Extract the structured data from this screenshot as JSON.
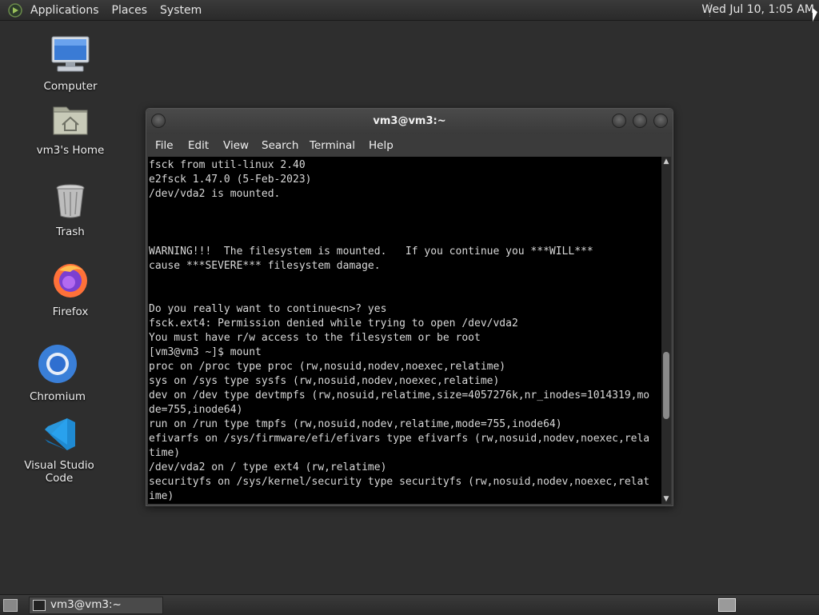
{
  "top_panel": {
    "menus": [
      "Applications",
      "Places",
      "System"
    ],
    "clock": "Wed Jul 10,  1:05 AM"
  },
  "desktop_icons": [
    {
      "label": "Computer",
      "icon": "computer-icon"
    },
    {
      "label": "vm3's Home",
      "icon": "home-folder-icon"
    },
    {
      "label": "Trash",
      "icon": "trash-icon"
    },
    {
      "label": "Firefox",
      "icon": "firefox-icon"
    },
    {
      "label": "Chromium",
      "icon": "chromium-icon"
    },
    {
      "label": "Visual Studio Code",
      "icon": "vscode-icon"
    }
  ],
  "terminal": {
    "title": "vm3@vm3:~",
    "menu": [
      "File",
      "Edit",
      "View",
      "Search",
      "Terminal",
      "Help"
    ],
    "output": "fsck from util-linux 2.40\ne2fsck 1.47.0 (5-Feb-2023)\n/dev/vda2 is mounted.\n\n\n\nWARNING!!!  The filesystem is mounted.   If you continue you ***WILL***\ncause ***SEVERE*** filesystem damage.\n\n\nDo you really want to continue<n>? yes\nfsck.ext4: Permission denied while trying to open /dev/vda2\nYou must have r/w access to the filesystem or be root\n[vm3@vm3 ~]$ mount\nproc on /proc type proc (rw,nosuid,nodev,noexec,relatime)\nsys on /sys type sysfs (rw,nosuid,nodev,noexec,relatime)\ndev on /dev type devtmpfs (rw,nosuid,relatime,size=4057276k,nr_inodes=1014319,mo\nde=755,inode64)\nrun on /run type tmpfs (rw,nosuid,nodev,relatime,mode=755,inode64)\nefivarfs on /sys/firmware/efi/efivars type efivarfs (rw,nosuid,nodev,noexec,rela\ntime)\n/dev/vda2 on / type ext4 (rw,relatime)\nsecurityfs on /sys/kernel/security type securityfs (rw,nosuid,nodev,noexec,relat\nime)"
  },
  "taskbar": {
    "task_label": "vm3@vm3:~"
  },
  "colors": {
    "desktop_bg": "#2e2e2e",
    "terminal_bg": "#000000",
    "terminal_fg": "#d8d8d8"
  }
}
